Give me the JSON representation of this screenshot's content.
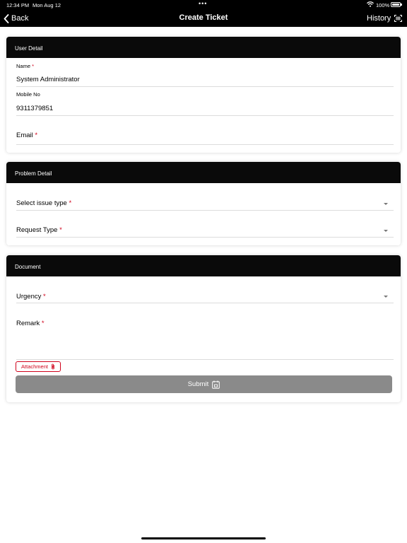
{
  "status_bar": {
    "time": "12:34 PM",
    "date": "Mon Aug 12",
    "dots": "•••",
    "battery": "100%"
  },
  "nav": {
    "back_label": "Back",
    "title": "Create Ticket",
    "history_label": "History"
  },
  "user_detail": {
    "header": "User Detail",
    "name_label": "Name",
    "name_required": "*",
    "name_value": "System Administrator",
    "mobile_label": "Mobile No",
    "mobile_value": "9311379851",
    "email_label": "Email",
    "email_required": "*"
  },
  "problem_detail": {
    "header": "Problem Detail",
    "issue_type_label": "Select issue type",
    "issue_type_required": "*",
    "request_type_label": "Request Type",
    "request_type_required": "*"
  },
  "document": {
    "header": "Document",
    "urgency_label": "Urgency",
    "urgency_required": "*",
    "remark_label": "Remark",
    "remark_required": "*",
    "attachment_label": "Attachment",
    "submit_label": "Submit"
  },
  "colors": {
    "header_bg": "#0a0a0a",
    "required": "#d0021b",
    "submit_bg": "#8a8a8a"
  }
}
